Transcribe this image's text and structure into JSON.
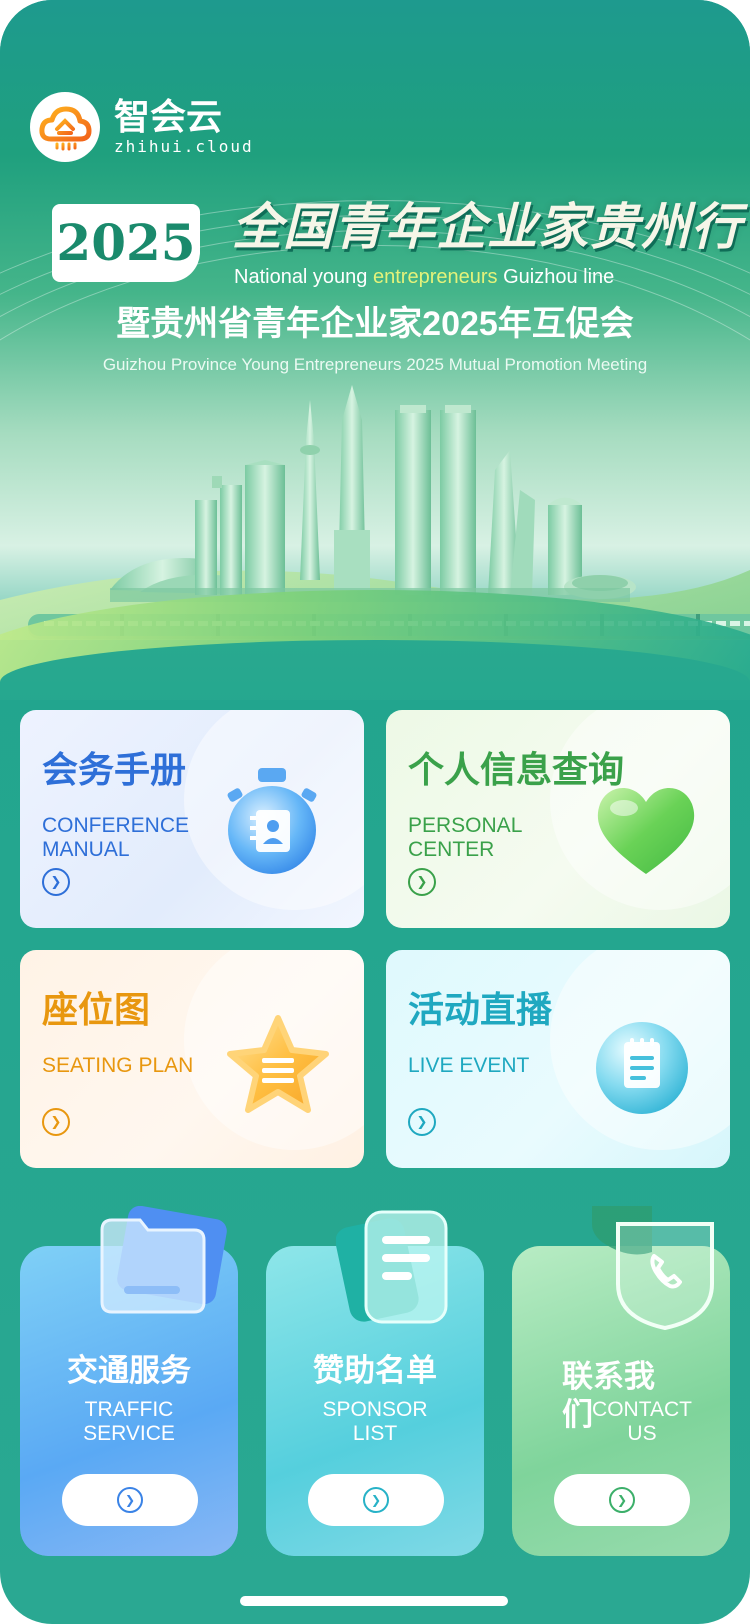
{
  "brand": {
    "logo_cn": "智会云",
    "logo_en": "zhihui.cloud"
  },
  "hero": {
    "year": "2025",
    "title_cn": "全国青年企业家贵州行",
    "title_en_prefix": "National young ",
    "title_en_highlight": "entrepreneurs",
    "title_en_suffix": " Guizhou line",
    "subtitle_cn": "暨贵州省青年企业家2025年互促会",
    "subtitle_en": "Guizhou Province Young Entrepreneurs 2025 Mutual Promotion Meeting"
  },
  "cards": [
    {
      "title": "会务手册",
      "subtitle": "CONFERENCE MANUAL",
      "icon": "handbook-icon",
      "color": "#2e6fd8"
    },
    {
      "title": "个人信息查询",
      "subtitle": "PERSONAL CENTER",
      "icon": "heart-icon",
      "color": "#3aa14a"
    },
    {
      "title": "座位图",
      "subtitle": "SEATING PLAN",
      "icon": "star-icon",
      "color": "#e8970f"
    },
    {
      "title": "活动直播",
      "subtitle": "LIVE EVENT",
      "icon": "notepad-icon",
      "color": "#1fa8c0"
    }
  ],
  "tiles": [
    {
      "title": "交通服务",
      "subtitle": "TRAFFIC SERVICE",
      "icon": "folder-icon",
      "color": "#3a83e6"
    },
    {
      "title": "赞助名单",
      "subtitle": "SPONSOR LIST",
      "icon": "document-icon",
      "color": "#27b2c7"
    },
    {
      "title": "联系我们",
      "subtitle": "CONTACT US",
      "icon": "phone-icon",
      "color": "#3caf6a"
    }
  ]
}
